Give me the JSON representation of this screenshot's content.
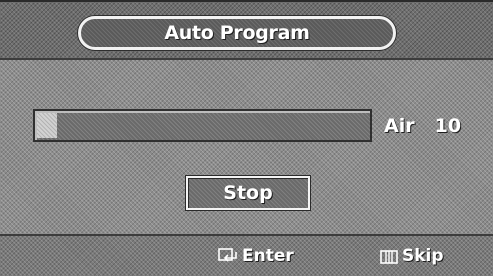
{
  "window": {
    "title": "Auto Program"
  },
  "scan": {
    "signal_type": "Air",
    "channel": "10",
    "progress_fraction": 0.06
  },
  "buttons": {
    "stop_label": "Stop"
  },
  "footer": {
    "enter_icon": "enter-icon",
    "enter_label": "Enter",
    "skip_icon": "menu-icon",
    "skip_label": "Skip"
  },
  "colors": {
    "text": "#ffffff",
    "panel": "#8c8c8c",
    "progress_fill": "#d2d2d2"
  }
}
